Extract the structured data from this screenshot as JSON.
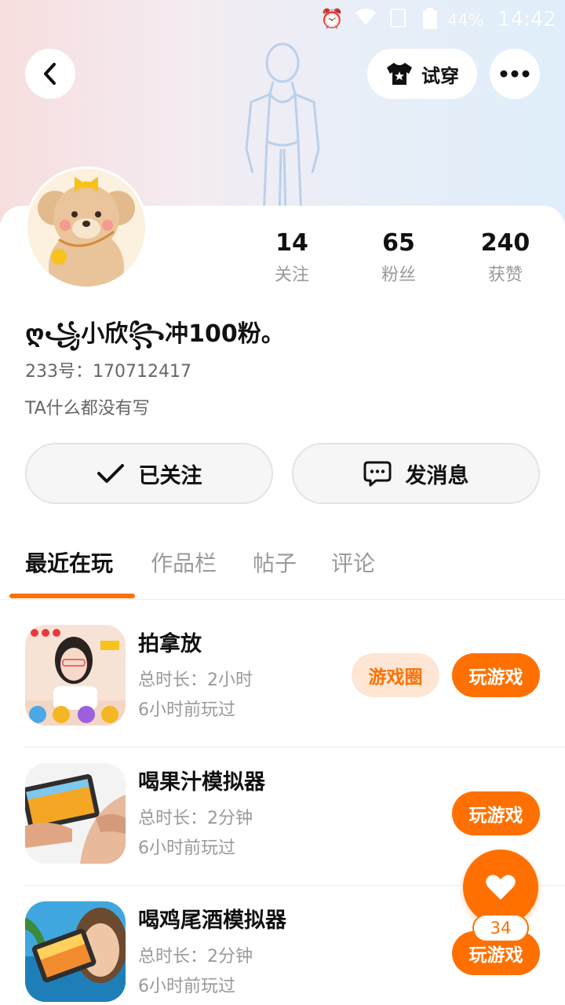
{
  "status_bar": {
    "battery": "44%",
    "time": "14:42"
  },
  "header": {
    "try_on_label": "试穿"
  },
  "profile": {
    "stats": [
      {
        "value": "14",
        "label": "关注"
      },
      {
        "value": "65",
        "label": "粉丝"
      },
      {
        "value": "240",
        "label": "获赞"
      }
    ],
    "nickname": "ღ꧁小欣꧂冲100粉。",
    "id_line": "233号：170712417",
    "bio": "TA什么都没有写"
  },
  "actions": {
    "follow_label": "已关注",
    "message_label": "发消息"
  },
  "tabs": [
    "最近在玩",
    "作品栏",
    "帖子",
    "评论"
  ],
  "games": [
    {
      "title": "拍拿放",
      "duration": "总时长：2小时",
      "last_played": "6小时前玩过",
      "circle_label": "游戏圈",
      "play_label": "玩游戏"
    },
    {
      "title": "喝果汁模拟器",
      "duration": "总时长：2分钟",
      "last_played": "6小时前玩过",
      "play_label": "玩游戏"
    },
    {
      "title": "喝鸡尾酒模拟器",
      "duration": "总时长：2分钟",
      "last_played": "6小时前玩过",
      "play_label": "玩游戏"
    }
  ],
  "like_fab": {
    "count": "34"
  },
  "colors": {
    "accent": "#ff7000",
    "accent_light": "#fde6d4"
  }
}
